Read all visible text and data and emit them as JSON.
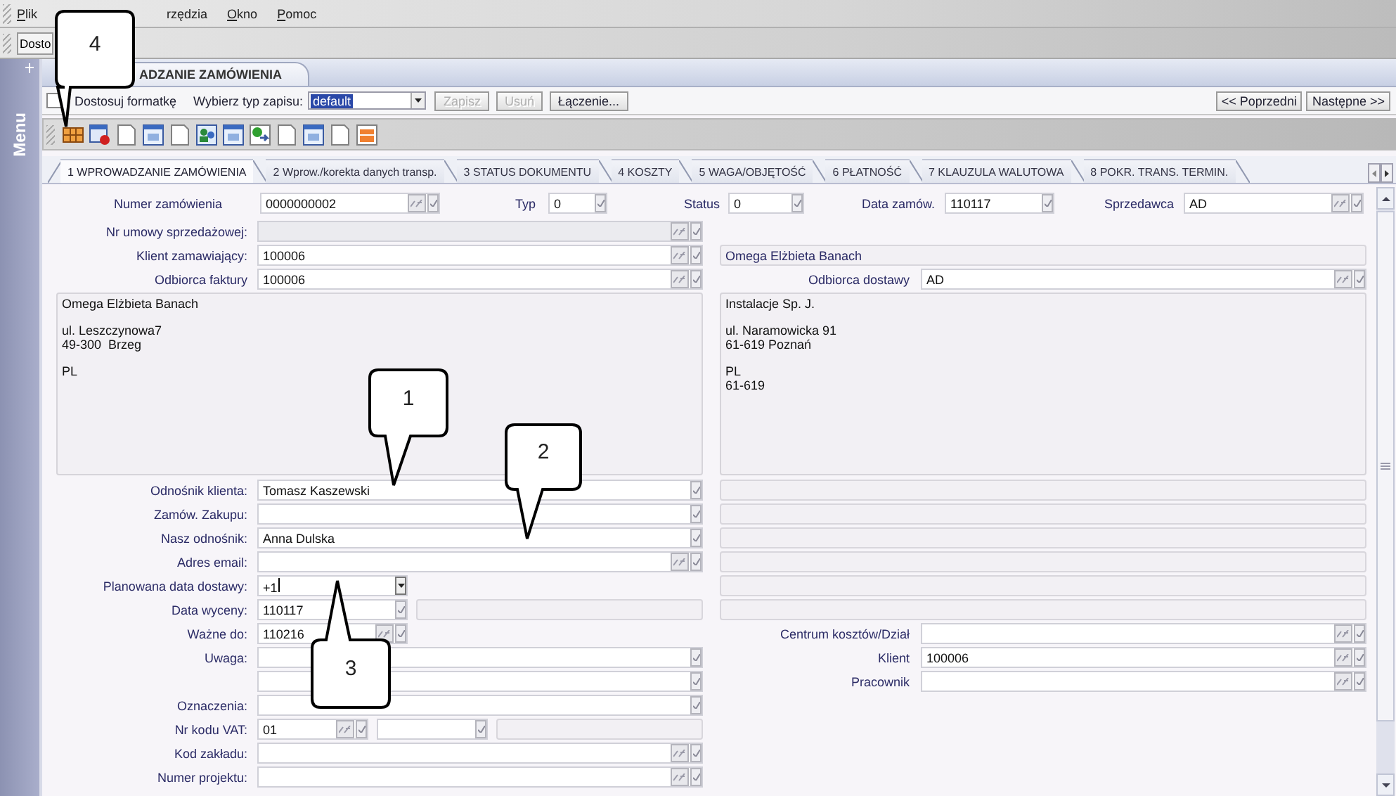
{
  "menu": [
    {
      "label": "Plik",
      "mnemonic": true
    },
    {
      "label": "rzędzia",
      "mnemonic": false
    },
    {
      "label": "Okno",
      "mnemonic": true
    },
    {
      "label": "Pomoc",
      "mnemonic": true
    }
  ],
  "toolbar": {
    "button": "Dosto"
  },
  "sidebar": {
    "label": "Menu"
  },
  "document_tab": {
    "label": "ADZANIE ZAMÓWIENIA"
  },
  "options": {
    "checkbox": {
      "label": "Dostosuj formatkę",
      "checked": false
    },
    "record_type_label": "Wybierz typ zapisu:",
    "record_type": {
      "value": "default",
      "highlighted": true
    },
    "buttons": [
      {
        "label": "Zapisz",
        "disabled": true
      },
      {
        "label": "Usuń",
        "disabled": true
      },
      {
        "label": "Łączenie...",
        "disabled": false
      }
    ],
    "nav": [
      "<< Poprzedni",
      "Następne >>"
    ]
  },
  "tabs": [
    {
      "label": "1 WPROWADZANIE ZAMÓWIENIA",
      "selected": true
    },
    {
      "label": "2 Wprow./korekta danych transp.",
      "selected": false
    },
    {
      "label": "3 STATUS DOKUMENTU",
      "selected": false
    },
    {
      "label": "4 KOSZTY",
      "selected": false
    },
    {
      "label": "5 WAGA/OBJĘTOŚĆ",
      "selected": false
    },
    {
      "label": "6 PŁATNOŚĆ",
      "selected": false
    },
    {
      "label": "7 KLAUZULA WALUTOWA",
      "selected": false
    },
    {
      "label": "8 POKR. TRANS. TERMIN.",
      "selected": false
    }
  ],
  "header": [
    {
      "label": "Numer zamówienia",
      "value": "0000000002",
      "kind": "lookup"
    },
    {
      "label": "Typ",
      "value": "0",
      "kind": "text"
    },
    {
      "label": "Status",
      "value": "0",
      "kind": "text"
    },
    {
      "label": "Data zamów.",
      "value": "110117",
      "kind": "text"
    },
    {
      "label": "Sprzedawca",
      "value": "AD",
      "kind": "lookup"
    }
  ],
  "left": {
    "top_rows": [
      {
        "label": "Nr umowy sprzedażowej:",
        "fields": [
          {
            "kind": "lookup",
            "disabled": true
          }
        ]
      },
      {
        "label": "Klient zamawiający:",
        "fields": [
          {
            "kind": "lookup",
            "value": "100006",
            "disabled": false
          }
        ]
      },
      {
        "label": "Odbiorca faktury",
        "fields": [
          {
            "kind": "lookup",
            "value": "100006",
            "disabled": false
          }
        ]
      }
    ],
    "address": [
      [
        "Omega Elżbieta Banach"
      ],
      [
        "ul. Leszczynowa7",
        "49-300  Brzeg"
      ],
      [
        "PL"
      ]
    ],
    "rows": [
      {
        "label": "Odnośnik klienta:",
        "fields": [
          {
            "kind": "text",
            "value": "Tomasz Kaszewski",
            "disabled": false
          }
        ]
      },
      {
        "label": "Zamów. Zakupu:",
        "fields": [
          {
            "kind": "text",
            "disabled": false
          }
        ]
      },
      {
        "label": "Nasz odnośnik:",
        "fields": [
          {
            "kind": "text",
            "value": "Anna Dulska",
            "disabled": false
          }
        ]
      },
      {
        "label": "Adres email:",
        "fields": [
          {
            "kind": "lookup",
            "disabled": false
          }
        ]
      },
      {
        "label": "Planowana data dostawy:",
        "fields": [
          {
            "kind": "combo",
            "value": "+1",
            "disabled": false
          }
        ]
      },
      {
        "label": "Data wyceny:",
        "fields": [
          {
            "kind": "text",
            "value": "110117",
            "disabled": false
          },
          {
            "kind": "note"
          }
        ]
      },
      {
        "label": "Ważne do:",
        "fields": [
          {
            "kind": "lookup",
            "value": "110216",
            "disabled": false
          }
        ]
      },
      {
        "label": "Uwaga:",
        "fields": [
          {
            "kind": "text",
            "disabled": false
          }
        ]
      },
      {
        "fields": [
          {
            "kind": "text",
            "disabled": false
          }
        ]
      },
      {
        "label": "Oznaczenia:",
        "fields": [
          {
            "kind": "text",
            "disabled": false
          }
        ]
      },
      {
        "label": "Nr kodu VAT:",
        "fields": [
          {
            "kind": "lookup",
            "value": "01",
            "disabled": false
          },
          {
            "kind": "text",
            "disabled": false
          },
          {
            "kind": "note"
          }
        ]
      },
      {
        "label": "Kod zakładu:",
        "fields": [
          {
            "kind": "lookup",
            "disabled": false
          }
        ]
      },
      {
        "label": "Numer projektu:",
        "fields": [
          {
            "kind": "lookup",
            "disabled": false
          }
        ]
      }
    ]
  },
  "right": {
    "top_rows": [
      {
        "fields": [
          {
            "kind": "note",
            "value": "Omega Elżbieta Banach"
          }
        ]
      },
      {
        "label": "Odbiorca dostawy",
        "fields": [
          {
            "kind": "lookup",
            "value": "AD",
            "disabled": false
          }
        ]
      }
    ],
    "address": [
      [
        "Instalacje Sp. J."
      ],
      [
        "ul. Naramowicka 91",
        "61-619 Poznań"
      ],
      [
        "PL",
        "61-619"
      ]
    ],
    "rows": [
      {
        "fields": [
          {
            "kind": "note"
          }
        ]
      },
      {
        "fields": [
          {
            "kind": "note"
          }
        ]
      },
      {
        "fields": [
          {
            "kind": "note"
          }
        ]
      },
      {
        "fields": [
          {
            "kind": "note"
          }
        ]
      },
      {
        "fields": [
          {
            "kind": "note"
          }
        ]
      },
      {
        "fields": [
          {
            "kind": "note"
          }
        ]
      },
      {
        "label": "Centrum kosztów/Dział",
        "fields": [
          {
            "kind": "lookup",
            "disabled": false
          }
        ]
      },
      {
        "label": "Klient",
        "fields": [
          {
            "kind": "lookup",
            "value": "100006",
            "disabled": false
          }
        ]
      },
      {
        "label": "Pracownik",
        "fields": [
          {
            "kind": "lookup",
            "disabled": false
          }
        ]
      }
    ]
  },
  "callouts": [
    "4",
    "1",
    "2",
    "3"
  ]
}
